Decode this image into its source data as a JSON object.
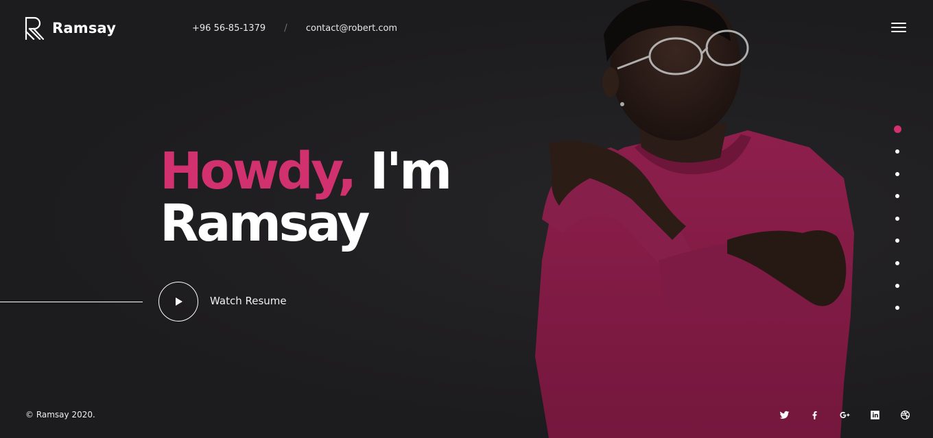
{
  "header": {
    "brand": "Ramsay",
    "phone": "+96 56-85-1379",
    "separator": "/",
    "email": "contact@robert.com"
  },
  "hero": {
    "greeting": "Howdy,",
    "intro": "I'm",
    "name": "Ramsay",
    "watch_resume": "Watch Resume"
  },
  "side_nav": {
    "dot_count": 9,
    "active_index": 0
  },
  "footer": {
    "copyright": "© Ramsay 2020.",
    "social_icons": [
      "twitter-icon",
      "facebook-icon",
      "google-plus-icon",
      "linkedin-icon",
      "dribbble-icon"
    ]
  },
  "colors": {
    "accent": "#d1316e",
    "background": "#1e1d1f",
    "text": "#ffffff",
    "sweater": "#8a1d4a"
  }
}
